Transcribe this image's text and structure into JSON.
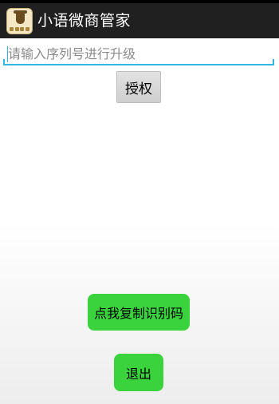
{
  "app": {
    "title": "小语微商管家",
    "icon": "tea-cup-app-icon",
    "action_bar_color": "#202020"
  },
  "serial_input": {
    "value": "",
    "placeholder": "请输入序列号进行升级",
    "accent_color": "#33b5e5"
  },
  "buttons": {
    "authorize_label": "授权",
    "copy_id_label": "点我复制识别码",
    "exit_label": "退出",
    "green_color": "#3ad33e"
  }
}
